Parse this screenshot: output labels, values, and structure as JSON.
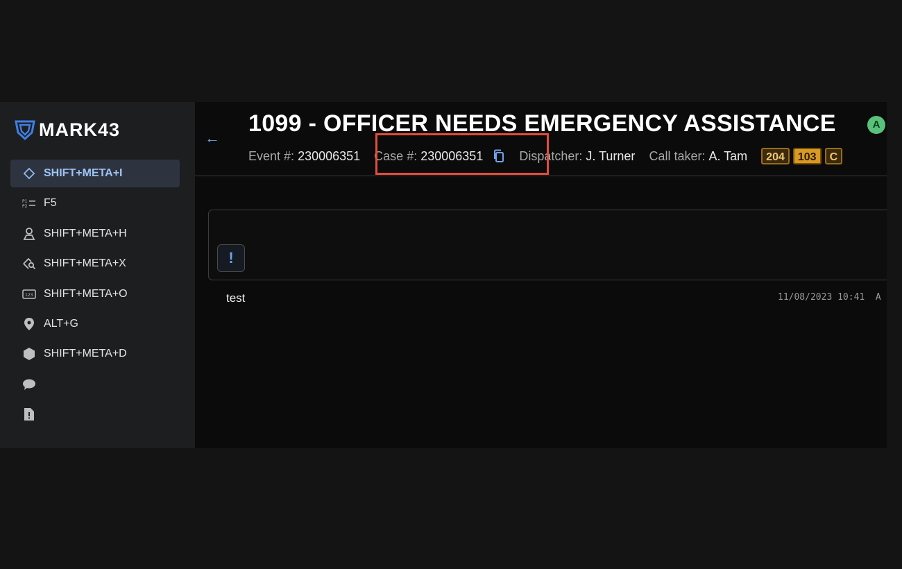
{
  "brand": {
    "name": "MARK43"
  },
  "sidebar": {
    "items": [
      {
        "label": "SHIFT+META+I",
        "icon": "diamond-icon",
        "active": true
      },
      {
        "label": "F5",
        "icon": "list-numbered-icon"
      },
      {
        "label": "SHIFT+META+H",
        "icon": "person-pin-icon"
      },
      {
        "label": "SHIFT+META+X",
        "icon": "location-search-icon"
      },
      {
        "label": "SHIFT+META+O",
        "icon": "keypad-icon"
      },
      {
        "label": "ALT+G",
        "icon": "map-pin-icon"
      },
      {
        "label": "SHIFT+META+D",
        "icon": "hexagon-icon"
      },
      {
        "label": "",
        "icon": "chat-icon"
      },
      {
        "label": "",
        "icon": "document-alert-icon"
      }
    ]
  },
  "header": {
    "title": "1099 - OFFICER NEEDS EMERGENCY ASSISTANCE",
    "status_badge": "A",
    "event_label": "Event #:",
    "event_value": "230006351",
    "case_label": "Case #:",
    "case_value": "230006351",
    "dispatcher_label": "Dispatcher:",
    "dispatcher_value": "J. Turner",
    "calltaker_label": "Call taker:",
    "calltaker_value": "A. Tam",
    "units": [
      "204",
      "103",
      "C"
    ]
  },
  "composer": {
    "alert_label": "!"
  },
  "messages": [
    {
      "text": "test",
      "timestamp": "11/08/2023 10:41",
      "author": "A"
    }
  ],
  "colors": {
    "accent": "#6ea3e8",
    "highlight_box": "#e24d3a",
    "unit_badge": "#d99a22",
    "status_green": "#58c27a"
  }
}
